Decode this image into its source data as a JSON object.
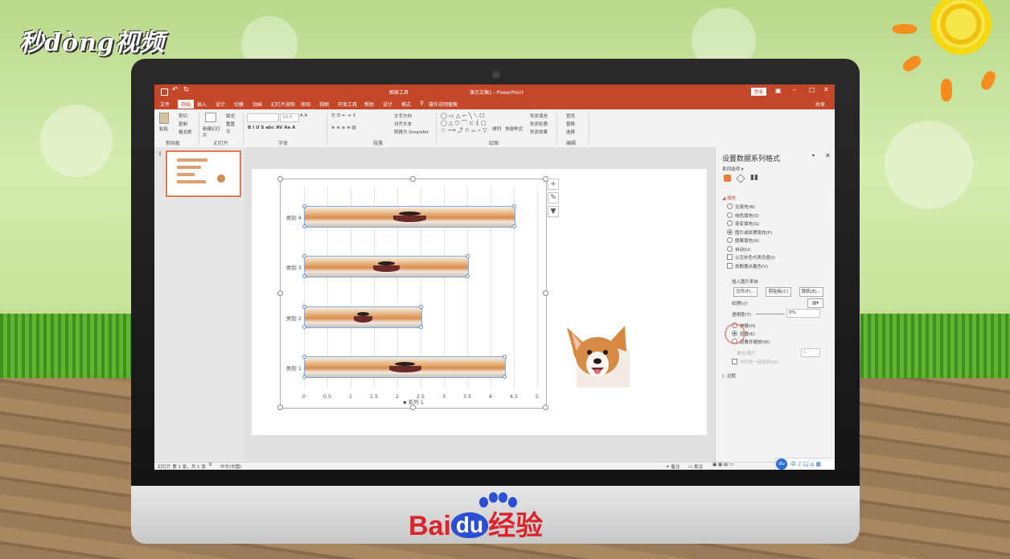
{
  "branding": {
    "top_logo": "秒dòng视频",
    "bottom_logo_bai": "Bai",
    "bottom_logo_du": "du",
    "bottom_logo_suffix": "经验"
  },
  "app": {
    "window_title": "演示文稿1 - PowerPoint",
    "context_tab_group": "图表工具",
    "login_button": "登录",
    "share_button": "共享",
    "tell_me": "操作说明搜索",
    "tabs": [
      "文件",
      "开始",
      "插入",
      "设计",
      "切换",
      "动画",
      "幻灯片放映",
      "审阅",
      "视图",
      "开发工具",
      "帮助",
      "设计",
      "格式"
    ],
    "active_tab": "开始"
  },
  "ribbon": {
    "groups": [
      "剪贴板",
      "幻灯片",
      "字体",
      "段落",
      "绘图",
      "编辑"
    ],
    "clipboard": {
      "paste": "粘贴",
      "cut": "剪切",
      "copy": "复制",
      "format_painter": "格式刷"
    },
    "slides": {
      "new_slide": "新建幻灯片",
      "layout": "版式",
      "reset": "重置",
      "section": "节"
    },
    "font": {
      "font_name": "",
      "font_size": "10.5"
    },
    "paragraph": {
      "text_direction": "文字方向",
      "align_text": "对齐文本",
      "smartart": "转换为 SmartArt"
    },
    "drawing": {
      "arrange": "排列",
      "quick_styles": "快速样式",
      "shape_fill": "形状填充",
      "shape_outline": "形状轮廓",
      "shape_effects": "形状效果"
    },
    "editing": {
      "find": "查找",
      "replace": "替换",
      "select": "选择"
    }
  },
  "thumbnail": {
    "number": "1"
  },
  "chart_data": {
    "type": "bar",
    "orientation": "horizontal",
    "categories": [
      "类别 1",
      "类别 2",
      "类别 3",
      "类别 4"
    ],
    "series": [
      {
        "name": "系列 1",
        "values": [
          4.3,
          2.5,
          3.5,
          4.5
        ]
      }
    ],
    "xlim": [
      0,
      5
    ],
    "xticks": [
      "0",
      "0.5",
      "1",
      "1.5",
      "2",
      "2.5",
      "3",
      "3.5",
      "4",
      "4.5",
      "5"
    ],
    "legend": "bottom",
    "legend_label": "系列 1",
    "fill": "picture",
    "grid": true
  },
  "format_pane": {
    "title": "设置数据系列格式",
    "series_options": "系列选项",
    "fill_section": "填充",
    "fill_options": [
      {
        "label": "无填充(N)",
        "type": "radio",
        "on": false
      },
      {
        "label": "纯色填充(S)",
        "type": "radio",
        "on": false
      },
      {
        "label": "渐变填充(G)",
        "type": "radio",
        "on": false
      },
      {
        "label": "图片或纹理填充(P)",
        "type": "radio",
        "on": true
      },
      {
        "label": "图案填充(A)",
        "type": "radio",
        "on": false
      },
      {
        "label": "自动(U)",
        "type": "radio",
        "on": false
      },
      {
        "label": "以互补色代表负值(I)",
        "type": "check",
        "on": false
      },
      {
        "label": "依数据点着色(V)",
        "type": "check",
        "on": false
      }
    ],
    "insert_picture_from": "插入图片来自",
    "btn_file": "文件(F)...",
    "btn_clipboard": "剪贴板(C)",
    "btn_online": "联机(E)...",
    "texture": "纹理(U)",
    "transparency": "透明度(T)",
    "transparency_value": "0%",
    "stretch": "伸展(H)",
    "stack": "层叠(K)",
    "stack_scale": "层叠并缩放(W)",
    "units_per_picture": "单位/图片",
    "units_value": "1",
    "rotate_with_shape": "与形状一起旋转(W)",
    "border_section": "边框"
  },
  "statusbar": {
    "slide_info": "幻灯片 第 1 张，共 1 张",
    "language": "中文(中国)",
    "notes": "备注",
    "comments": "批注"
  },
  "colors": {
    "accent": "#c5472a",
    "baidu_red": "#d8262c",
    "baidu_blue": "#2b4fd3"
  }
}
